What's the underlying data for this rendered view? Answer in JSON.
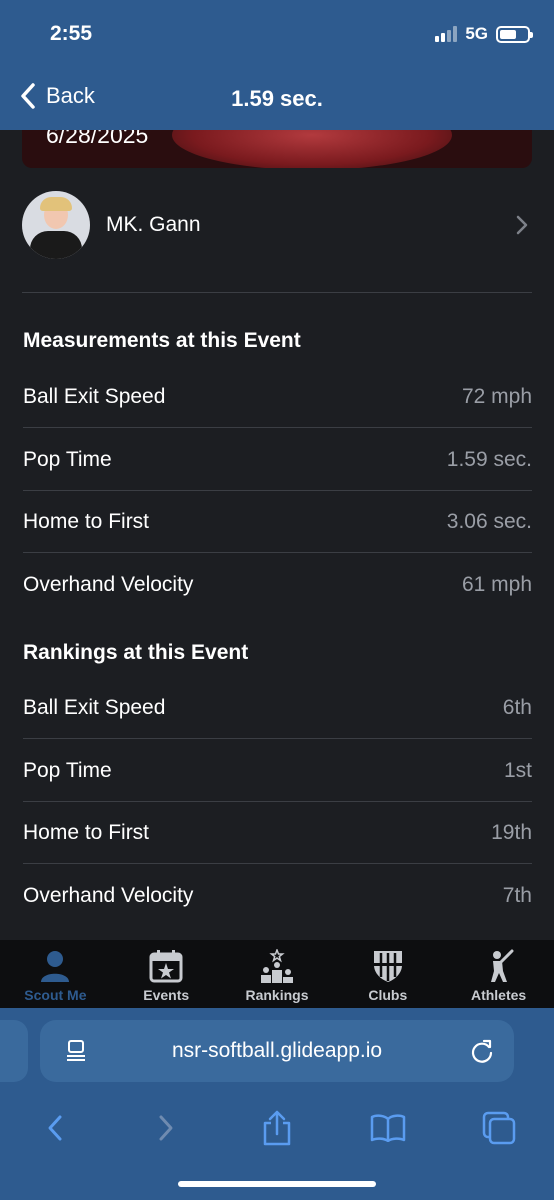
{
  "status": {
    "time": "2:55",
    "network": "5G"
  },
  "nav": {
    "back_label": "Back",
    "title": "1.59 sec."
  },
  "banner": {
    "date": "6/28/2025"
  },
  "profile": {
    "name": "MK. Gann"
  },
  "measurements": {
    "title": "Measurements at this Event",
    "rows": [
      {
        "label": "Ball Exit Speed",
        "value": "72 mph"
      },
      {
        "label": "Pop Time",
        "value": "1.59 sec."
      },
      {
        "label": "Home to First",
        "value": "3.06 sec."
      },
      {
        "label": "Overhand Velocity",
        "value": "61 mph"
      }
    ]
  },
  "rankings": {
    "title": "Rankings at this Event",
    "rows": [
      {
        "label": "Ball Exit Speed",
        "value": "6th"
      },
      {
        "label": "Pop Time",
        "value": "1st"
      },
      {
        "label": "Home to First",
        "value": "19th"
      },
      {
        "label": "Overhand Velocity",
        "value": "7th"
      }
    ]
  },
  "tabs": [
    {
      "label": "Scout Me",
      "icon": "person-icon",
      "active": true
    },
    {
      "label": "Events",
      "icon": "calendar-star-icon",
      "active": false
    },
    {
      "label": "Rankings",
      "icon": "podium-icon",
      "active": false
    },
    {
      "label": "Clubs",
      "icon": "shield-icon",
      "active": false
    },
    {
      "label": "Athletes",
      "icon": "batter-icon",
      "active": false
    }
  ],
  "browser": {
    "url": "nsr-softball.glideapp.io"
  },
  "colors": {
    "accent": "#2e5b8f",
    "background": "#1c1e22",
    "secondary_text": "#9a9ea6"
  }
}
